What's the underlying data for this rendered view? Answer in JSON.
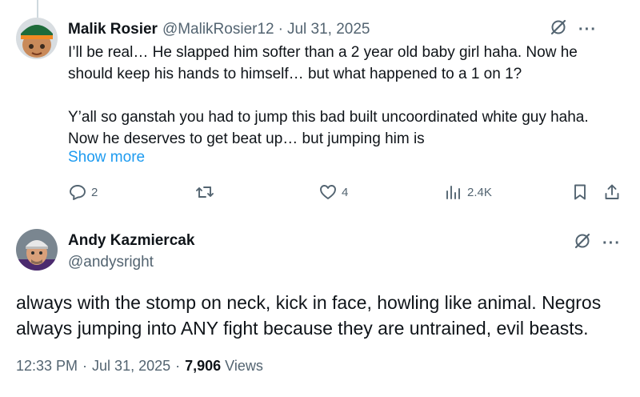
{
  "reply": {
    "name": "Malik Rosier",
    "handle": "@MalikRosier12",
    "date": "Jul 31, 2025",
    "body_paragraphs": [
      "I’ll be real… He slapped him softer than a 2 year old baby girl haha. Now he should keep his hands to himself… but what happened to a 1 on 1?",
      "Y’all so ganstah you had to jump this bad built uncoordinated white guy haha. Now he deserves to get beat up… but jumping him is"
    ],
    "show_more": "Show more",
    "replies_count": "2",
    "likes_count": "4",
    "views_count": "2.4K"
  },
  "main": {
    "name": "Andy Kazmiercak",
    "handle": "@andysright",
    "body": "always with the stomp on neck, kick in face, howling like animal. Negros always jumping into ANY fight because they are untrained, evil beasts.",
    "time": "12:33 PM",
    "date": "Jul 31, 2025",
    "views_count": "7,906",
    "views_label": "Views"
  },
  "separator": "·",
  "colors": {
    "text": "#0f1419",
    "secondary": "#536471",
    "link": "#1d9bf0",
    "thread_line": "#cfd9de"
  },
  "icons": [
    "grok-icon",
    "more-icon",
    "reply-icon",
    "retweet-icon",
    "like-icon",
    "views-icon",
    "bookmark-icon",
    "share-icon"
  ]
}
